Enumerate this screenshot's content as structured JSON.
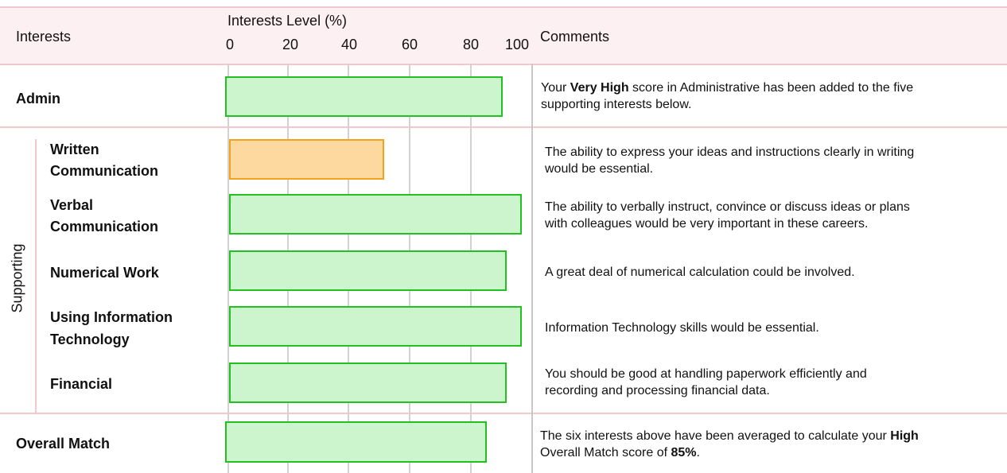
{
  "header": {
    "col1": "Interests",
    "axis_title": "Interests Level (%)",
    "col3": "Comments",
    "ticks": [
      "0",
      "20",
      "40",
      "60",
      "80",
      "100"
    ]
  },
  "side_label": "Supporting",
  "colors": {
    "green_fill": "#cdf5cd",
    "green_stroke": "#22c022",
    "orange_fill": "#fdd9a0",
    "orange_stroke": "#f3a21f"
  },
  "rows": {
    "admin": {
      "label": "Admin",
      "c1": "Your ",
      "c1b": "Very High",
      "c1c": " score in Administrative has been added to the five",
      "c2": "supporting interests below."
    },
    "written": {
      "label1": "Written",
      "label2": "Communication",
      "c1": "The ability to express your ideas and instructions clearly in writing",
      "c2": "would be essential."
    },
    "verbal": {
      "label1": "Verbal",
      "label2": "Communication",
      "c1": "The ability to verbally instruct, convince or discuss ideas or plans",
      "c2": "with colleagues would be very important in these careers."
    },
    "numerical": {
      "label": "Numerical Work",
      "c1": "A great deal of numerical calculation could be involved."
    },
    "it": {
      "label1": "Using Information",
      "label2": "Technology",
      "c1": "Information Technology skills would be essential."
    },
    "financial": {
      "label": "Financial",
      "c1": "You should be good at handling paperwork efficiently and",
      "c2": "recording and processing financial data."
    },
    "overall": {
      "label": "Overall Match",
      "c1": "The six interests above have been averaged to calculate your ",
      "c1b": "High",
      "c2": "Overall Match score of ",
      "c2b": "85%",
      "c2c": "."
    }
  },
  "chart_data": {
    "type": "bar",
    "xlabel": "Interests Level (%)",
    "xlim": [
      0,
      100
    ],
    "categories": [
      "Admin",
      "Written Communication",
      "Verbal Communication",
      "Numerical Work",
      "Using Information Technology",
      "Financial",
      "Overall Match"
    ],
    "values": [
      91,
      51,
      96,
      91,
      96,
      91,
      86
    ],
    "bar_colors": [
      "green",
      "orange",
      "green",
      "green",
      "green",
      "green",
      "green"
    ]
  }
}
